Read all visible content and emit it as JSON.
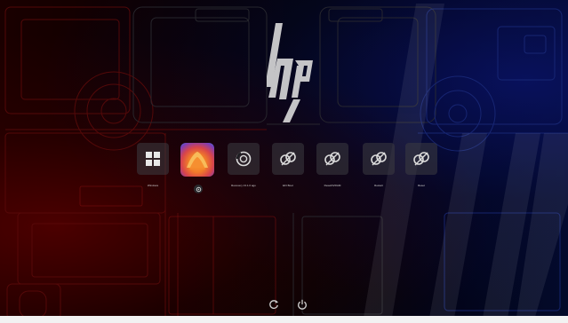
{
  "brand": {
    "logo_text": "hp"
  },
  "boot_menu": {
    "items": [
      {
        "id": "windows",
        "label": "Windows",
        "icon": "windows-logo-icon"
      },
      {
        "id": "macos",
        "label": "",
        "icon": "macos-ventura-app-icon",
        "badge_icon": "settings-gear-icon"
      },
      {
        "id": "recovery",
        "label": "Recovery 13.1.0 ago",
        "icon": "recovery-disk-icon"
      },
      {
        "id": "efi-boot",
        "label": "EFI Boot",
        "icon": "broken-link-disk-icon"
      },
      {
        "id": "resetnvram",
        "label": "ResetNVRAM",
        "icon": "broken-link-disk-icon"
      },
      {
        "id": "restart",
        "label": "Restart",
        "icon": "broken-link-disk-icon"
      },
      {
        "id": "reset",
        "label": "Reset",
        "icon": "broken-link-disk-icon"
      }
    ]
  },
  "controls": {
    "restart_icon": "restart-icon",
    "shutdown_icon": "power-icon"
  },
  "colors": {
    "left_glow": "#7a0000",
    "right_glow": "#0a1470",
    "tile_bg": "#3c3c42",
    "label": "#cfcfcf",
    "frame": "#f2f2f2"
  }
}
